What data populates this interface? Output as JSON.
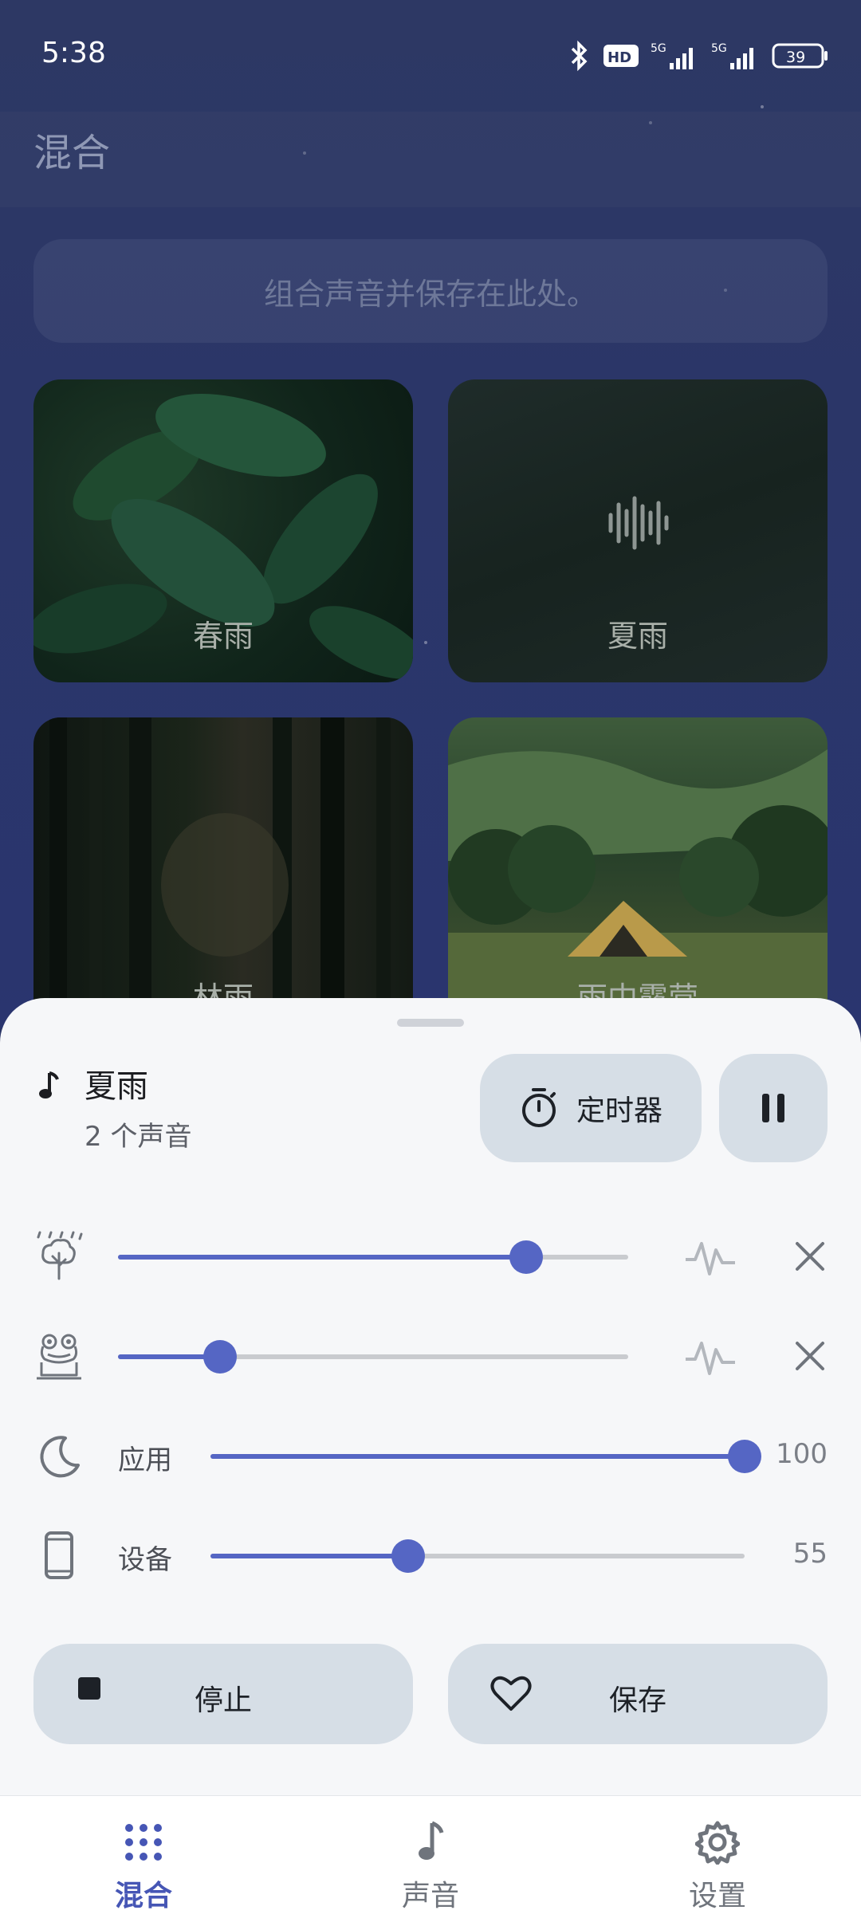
{
  "status_bar": {
    "time": "5:38",
    "battery": "39",
    "network": "5G",
    "hd": "HD"
  },
  "app": {
    "title": "混合"
  },
  "hint": {
    "text": "组合声音并保存在此处。"
  },
  "mixes": [
    {
      "label": "春雨"
    },
    {
      "label": "夏雨"
    },
    {
      "label": "林雨"
    },
    {
      "label": "雨中露营"
    }
  ],
  "now_playing": {
    "title": "夏雨",
    "subtitle": "2 个声音"
  },
  "timer_button": {
    "label": "定时器"
  },
  "sounds": [
    {
      "icon": "tree-rain-icon",
      "level": 0.8
    },
    {
      "icon": "frog-icon",
      "level": 0.2
    }
  ],
  "volume": {
    "app": {
      "label": "应用",
      "value": "100",
      "level": 1.0
    },
    "device": {
      "label": "设备",
      "value": "55",
      "level": 0.37
    }
  },
  "actions": {
    "stop_label": "停止",
    "save_label": "保存"
  },
  "bottom_nav": [
    {
      "label": "混合",
      "active": true,
      "icon": "grid-dots-icon"
    },
    {
      "label": "声音",
      "active": false,
      "icon": "music-note-icon"
    },
    {
      "label": "设置",
      "active": false,
      "icon": "gear-icon"
    }
  ],
  "colors": {
    "accent": "#5566c4",
    "active_nav": "#4656b5",
    "inactive_nav": "#6f747c"
  }
}
